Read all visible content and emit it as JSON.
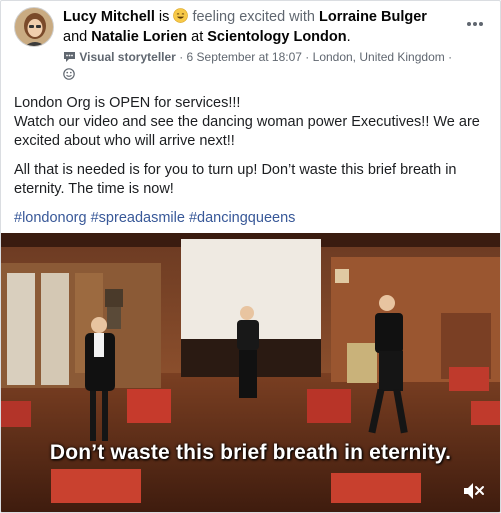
{
  "post": {
    "author": "Lucy Mitchell",
    "is_text": "is",
    "feeling_text": "feeling excited with",
    "tagged_1": "Lorraine Bulger",
    "and_text": "and",
    "tagged_2": "Natalie Lorien",
    "at_text": "at",
    "location_page": "Scientology London",
    "period": ".",
    "role_badge": "Visual storyteller",
    "timestamp": "6 September at 18:07",
    "location": "London, United Kingdom",
    "separator": "·",
    "paragraph_1": "London Org is OPEN for services!!!\nWatch our video and see the dancing woman power Executives!! We are excited about who will arrive next!!",
    "paragraph_2": "All that is needed is for you to turn up! Don’t waste this brief breath in eternity. The time is now!",
    "hashtags": [
      "#londonorg",
      "#spreadasmile",
      "#dancingqueens"
    ]
  },
  "video": {
    "subtitle": "Don’t waste this brief breath in eternity."
  },
  "icons": {
    "more": "more-options-icon",
    "emoji": "smiley-emoji-icon",
    "badge": "visual-storyteller-icon",
    "audience": "audience-globe-icon",
    "mute": "speaker-muted-icon"
  },
  "colors": {
    "link": "#385898",
    "muted": "#606770",
    "text": "#050505"
  }
}
